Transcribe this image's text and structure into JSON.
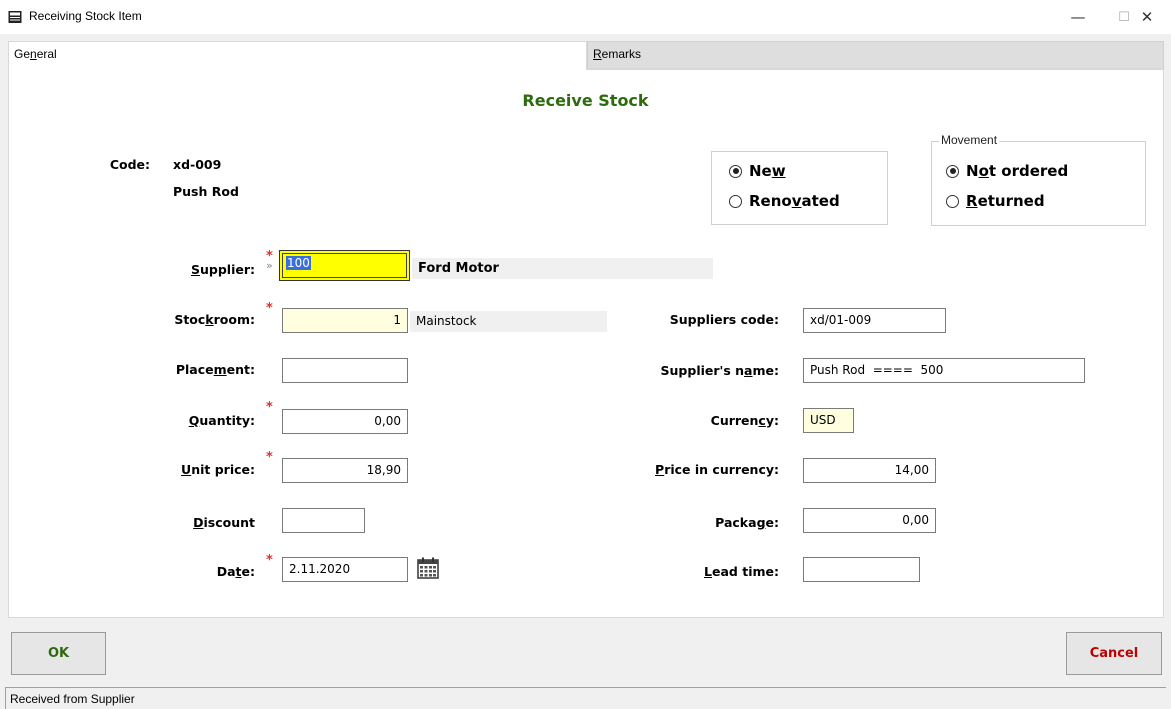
{
  "window": {
    "title": "Receiving Stock Item",
    "minimize": "—",
    "maximize": "☐",
    "close": "✕"
  },
  "tabs": {
    "general": {
      "pre": "Ge",
      "u": "n",
      "post": "eral"
    },
    "remarks": {
      "pre": "",
      "u": "R",
      "post": "emarks"
    }
  },
  "heading": "Receive Stock",
  "item": {
    "code_label": "Code:",
    "code": "xd-009",
    "name": "Push Rod"
  },
  "condition": {
    "new": {
      "pre": "Ne",
      "u": "w",
      "post": "",
      "selected": true
    },
    "renovated": {
      "pre": "Reno",
      "u": "v",
      "post": "ated",
      "selected": false
    }
  },
  "movement": {
    "legend": "Movement",
    "not_ordered": {
      "pre": "N",
      "u": "o",
      "post": "t ordered",
      "selected": true
    },
    "returned": {
      "pre": "",
      "u": "R",
      "post": "eturned",
      "selected": false
    }
  },
  "left": {
    "supplier": {
      "pre": "",
      "u": "S",
      "post": "upplier:",
      "value": "100",
      "name": "Ford Motor"
    },
    "stockroom": {
      "pre": "Stoc",
      "u": "k",
      "post": "room:",
      "value": "1",
      "name": "Mainstock"
    },
    "placement": {
      "pre": "Place",
      "u": "m",
      "post": "ent:",
      "value": ""
    },
    "quantity": {
      "pre": "",
      "u": "Q",
      "post": "uantity:",
      "value": "0,00"
    },
    "unit_price": {
      "pre": "",
      "u": "U",
      "post": "nit price:",
      "value": "18,90"
    },
    "discount": {
      "pre": "",
      "u": "D",
      "post": "iscount",
      "value": ""
    },
    "date": {
      "pre": "Da",
      "u": "t",
      "post": "e:",
      "value": "2.11.2020"
    }
  },
  "right": {
    "suppliers_code": {
      "label": "Suppliers code:",
      "value": "xd/01-009"
    },
    "suppliers_name": {
      "pre": "Supplier's n",
      "u": "a",
      "post": "me:",
      "value": "Push Rod  ====  500"
    },
    "currency": {
      "pre": "Curren",
      "u": "c",
      "post": "y:",
      "value": "USD"
    },
    "price_in_currency": {
      "pre": "",
      "u": "P",
      "post": "rice in currency:",
      "value": "14,00"
    },
    "package": {
      "pre": "Packa",
      "u": "g",
      "post": "e:",
      "value": "0,00"
    },
    "lead_time": {
      "pre": "",
      "u": "L",
      "post": "ead time:",
      "value": ""
    }
  },
  "required_mark": "*",
  "lookup_mark": "»",
  "buttons": {
    "ok": "OK",
    "cancel": "Cancel"
  },
  "colors": {
    "heading": "#2e6b0e",
    "ok_text": "#2e6b0e",
    "cancel_text": "#c00000",
    "required": "#e03030",
    "active_field": "#ffff00"
  },
  "status": "Received from Supplier"
}
